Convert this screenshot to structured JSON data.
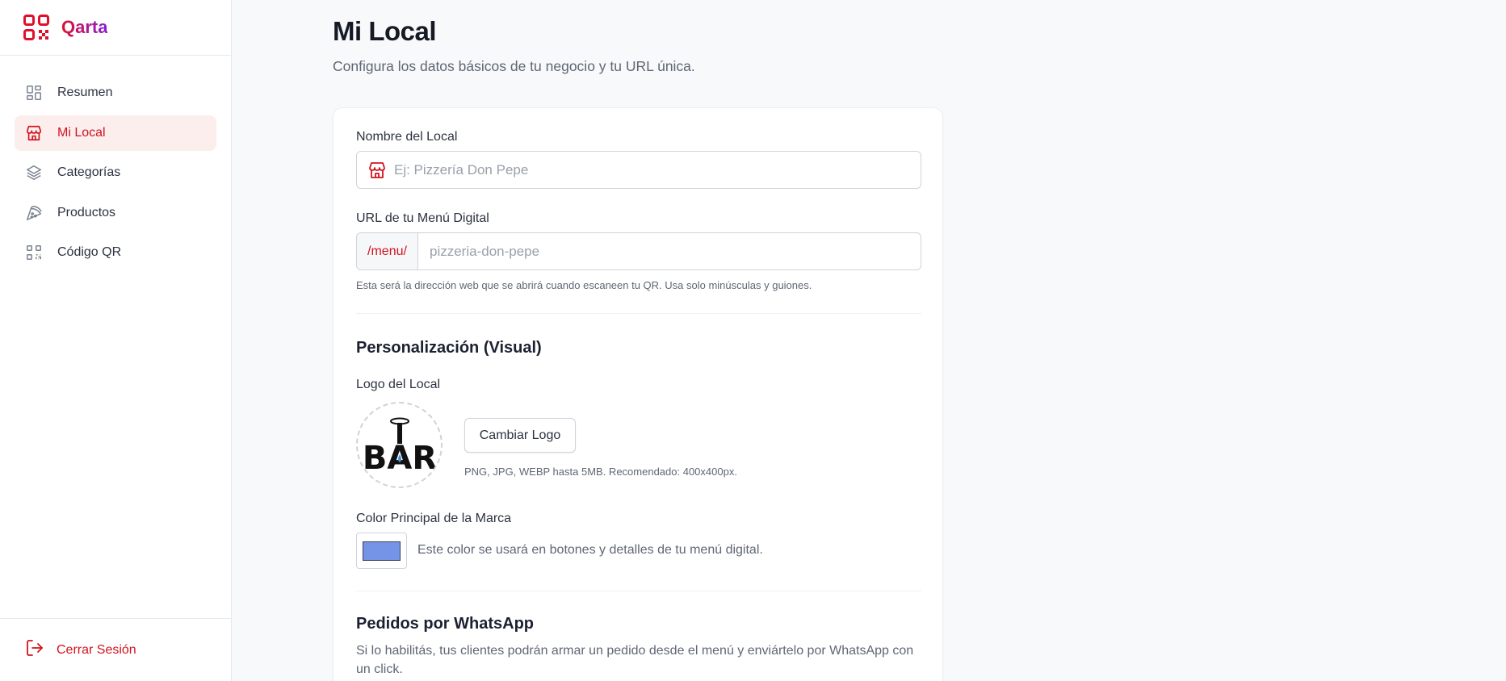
{
  "app": {
    "name": "Qarta",
    "brand_gradient": [
      "#e0102a",
      "#8a1ed8"
    ]
  },
  "sidebar": {
    "items": [
      {
        "label": "Resumen",
        "icon": "layout-grid-icon",
        "active": false
      },
      {
        "label": "Mi Local",
        "icon": "store-icon",
        "active": true
      },
      {
        "label": "Categorías",
        "icon": "layers-icon",
        "active": false
      },
      {
        "label": "Productos",
        "icon": "pizza-icon",
        "active": false
      },
      {
        "label": "Código QR",
        "icon": "qr-code-icon",
        "active": false
      }
    ],
    "logout": {
      "label": "Cerrar Sesión",
      "icon": "log-out-icon"
    }
  },
  "page": {
    "title": "Mi Local",
    "subtitle": "Configura los datos básicos de tu negocio y tu URL única."
  },
  "form": {
    "name_label": "Nombre del Local",
    "name_placeholder": "Ej: Pizzería Don Pepe",
    "url_label": "URL de tu Menú Digital",
    "url_prefix": "/menu/",
    "url_placeholder": "pizzeria-don-pepe",
    "url_help": "Esta será la dirección web que se abrirá cuando escaneen tu QR. Usa solo minúsculas y guiones.",
    "visual_section_title": "Personalización (Visual)",
    "logo_label": "Logo del Local",
    "logo_text": "BAR",
    "change_logo_button": "Cambiar Logo",
    "logo_help": "PNG, JPG, WEBP hasta 5MB. Recomendado: 400x400px.",
    "brand_color_label": "Color Principal de la Marca",
    "brand_color_value": "#7594e8",
    "brand_color_help": "Este color se usará en botones y detalles de tu menú digital.",
    "whatsapp_section_title": "Pedidos por WhatsApp",
    "whatsapp_description": "Si lo habilitás, tus clientes podrán armar un pedido desde el menú y enviártelo por WhatsApp con un click."
  },
  "colors": {
    "accent": "#d2131f",
    "active_bg": "#fdeeee",
    "page_bg": "#f8f9fb"
  }
}
